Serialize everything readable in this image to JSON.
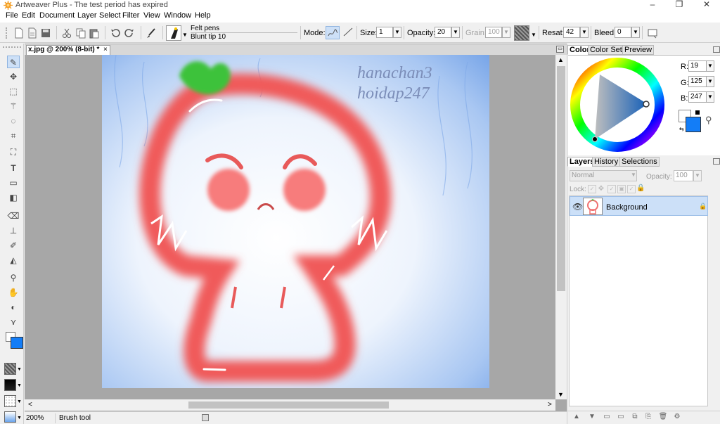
{
  "window": {
    "title": "Artweaver Plus - The test period has expired"
  },
  "menu": [
    "File",
    "Edit",
    "Document",
    "Layer",
    "Select",
    "Filter",
    "View",
    "Window",
    "Help"
  ],
  "toolbar": {
    "brush_category": "Felt pens",
    "brush_variant": "Blunt tip 10",
    "mode_label": "Mode:",
    "size_label": "Size:",
    "size_value": "1",
    "opacity_label": "Opacity:",
    "opacity_value": "20",
    "grain_label": "Grain:",
    "grain_value": "100",
    "resat_label": "Resat:",
    "resat_value": "42",
    "bleed_label": "Bleed:",
    "bleed_value": "0"
  },
  "document": {
    "tab_title": "x.jpg @ 200% (8-bit) *",
    "close_glyph": "×",
    "watermark_line1": "hanachan3",
    "watermark_line2": "hoidap247"
  },
  "status": {
    "zoom": "200%",
    "tool": "Brush tool"
  },
  "color_panel": {
    "tabs": [
      "Color",
      "Color Set",
      "Preview"
    ],
    "r_label": "R:",
    "r": "19",
    "g_label": "G:",
    "g": "125",
    "b_label": "B:",
    "b": "247",
    "foreground": "#137df7",
    "background": "#ffffff"
  },
  "layers_panel": {
    "tabs": [
      "Layers",
      "History",
      "Selections"
    ],
    "blend_mode": "Normal",
    "opacity_label": "Opacity:",
    "opacity_value": "100",
    "lock_label": "Lock:",
    "layers": [
      {
        "name": "Background"
      }
    ]
  },
  "colors": {
    "accent": "#3b7fe8",
    "selection": "#cce0f8"
  }
}
